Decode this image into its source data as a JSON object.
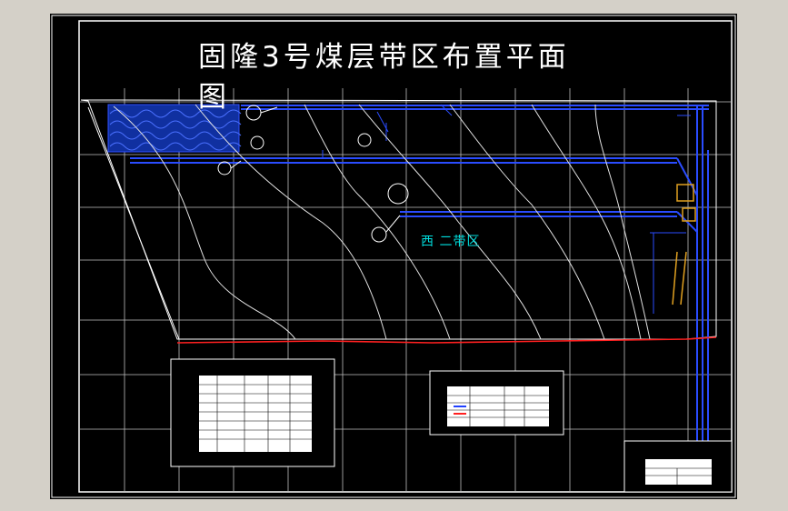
{
  "drawing": {
    "title": "固隆3号煤层带区布置平面图",
    "zone_label": "西  二带区",
    "colors": {
      "background": "#000000",
      "frame": "#ffffff",
      "grid": "#ffffff",
      "roadway": "#2040ff",
      "fault": "#ff2020",
      "label": "#00e0e0",
      "mine_structure": "#e0a020"
    }
  }
}
